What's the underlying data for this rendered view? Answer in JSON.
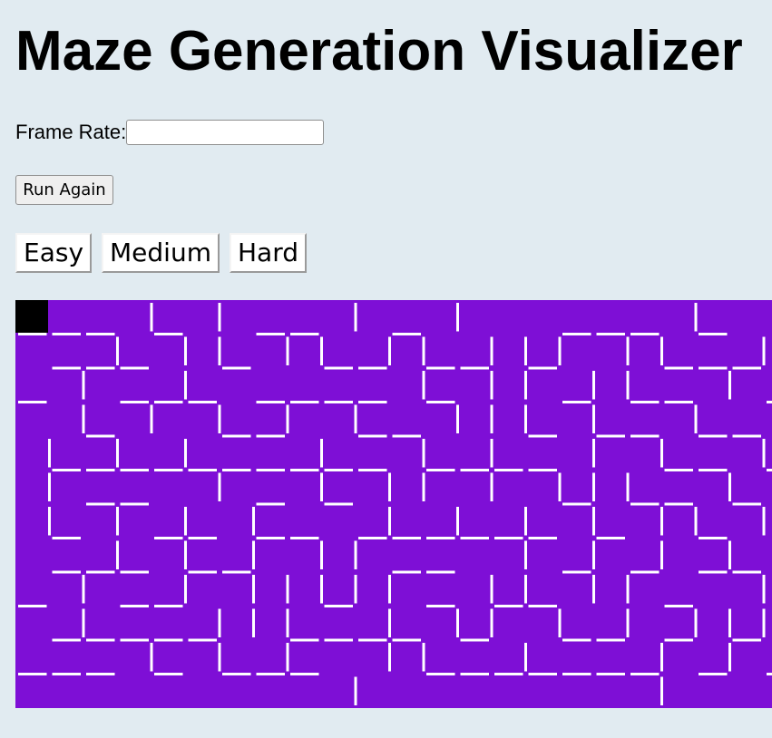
{
  "header": {
    "title": "Maze Generation Visualizer"
  },
  "controls": {
    "frame_rate_label": "Frame Rate:",
    "frame_rate_value": "",
    "run_again_label": "Run Again",
    "difficulty": [
      "Easy",
      "Medium",
      "Hard"
    ]
  },
  "maze": {
    "cell_color": "#7e0fd6",
    "wall_color": "#ffffff",
    "current_cell_color": "#000000",
    "current_cell": [
      0,
      0
    ]
  }
}
